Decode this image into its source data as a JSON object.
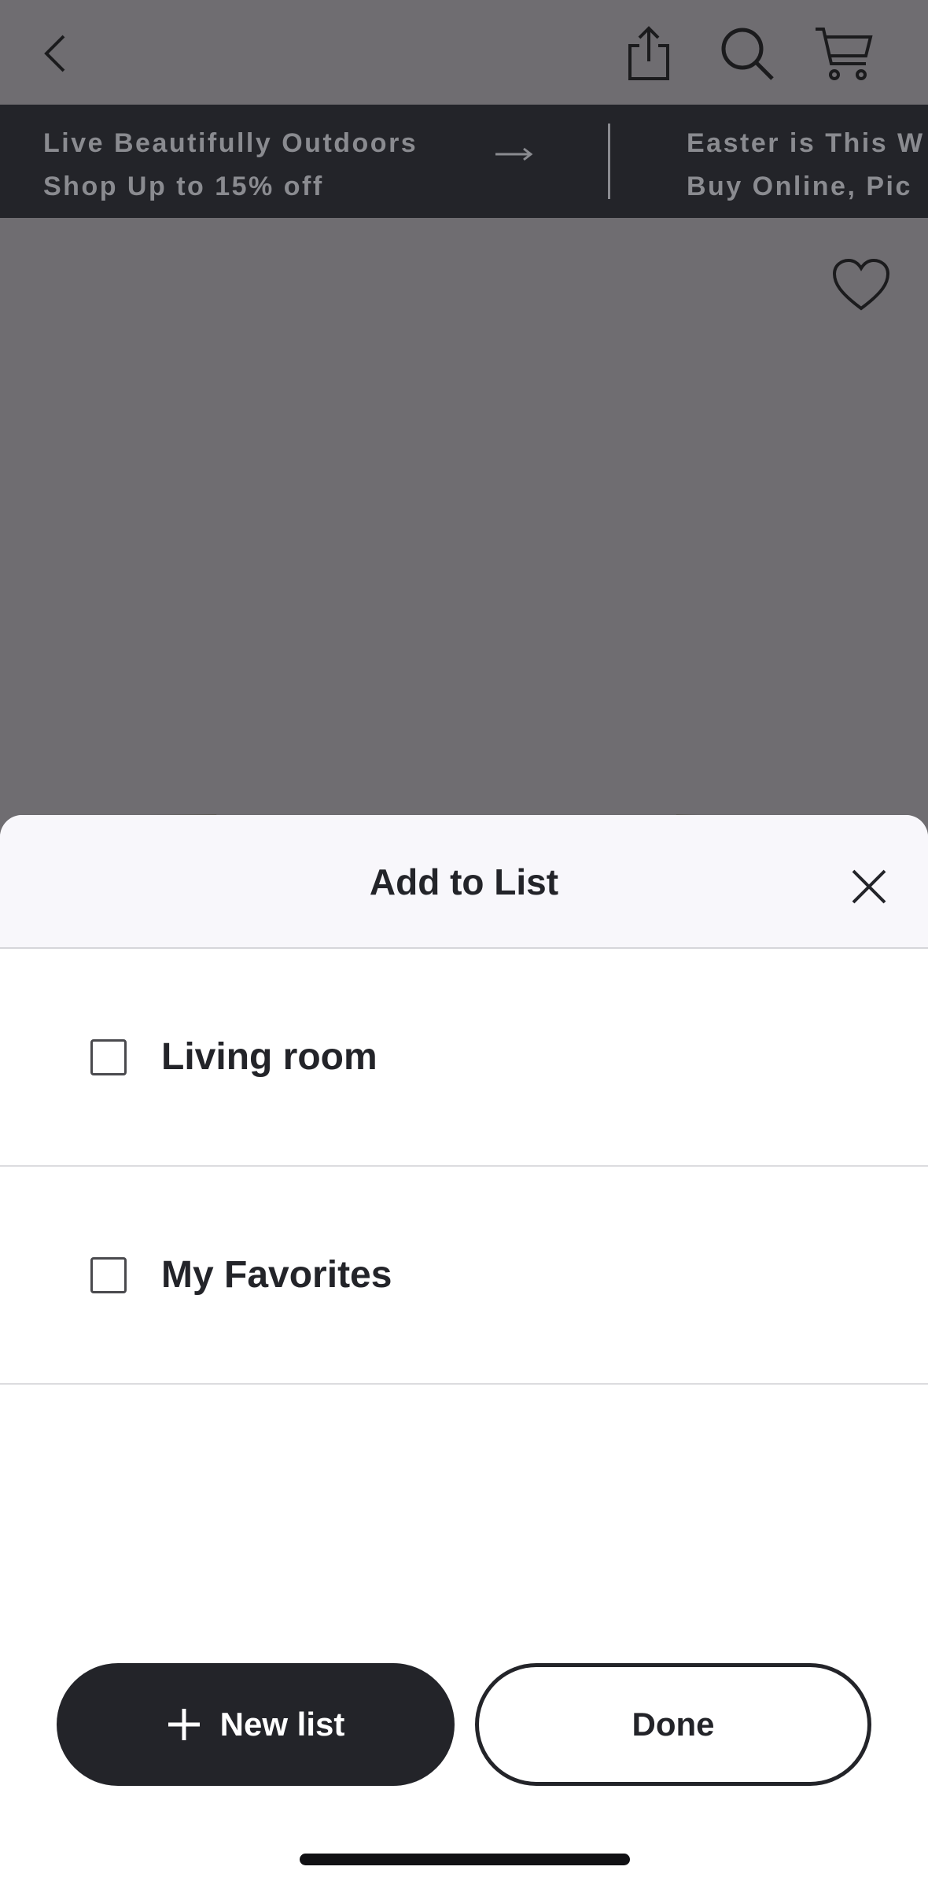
{
  "promo": {
    "items": [
      {
        "line1": "Live Beautifully Outdoors",
        "line2": "Shop Up to 15% off"
      },
      {
        "line1": "Easter is This W",
        "line2": "Buy Online, Pic"
      }
    ]
  },
  "sheet": {
    "title": "Add to List",
    "lists": [
      {
        "label": "Living room",
        "checked": false
      },
      {
        "label": "My Favorites",
        "checked": false
      }
    ],
    "new_list_label": "New list",
    "done_label": "Done"
  },
  "colors": {
    "dim_background": "#6f6d71",
    "promo_background": "#232429",
    "primary_button": "#232429",
    "sheet_header": "#f8f7fb"
  },
  "icons": [
    "back-icon",
    "share-icon",
    "search-icon",
    "cart-icon",
    "arrow-right-icon",
    "heart-icon",
    "close-icon",
    "plus-icon"
  ]
}
